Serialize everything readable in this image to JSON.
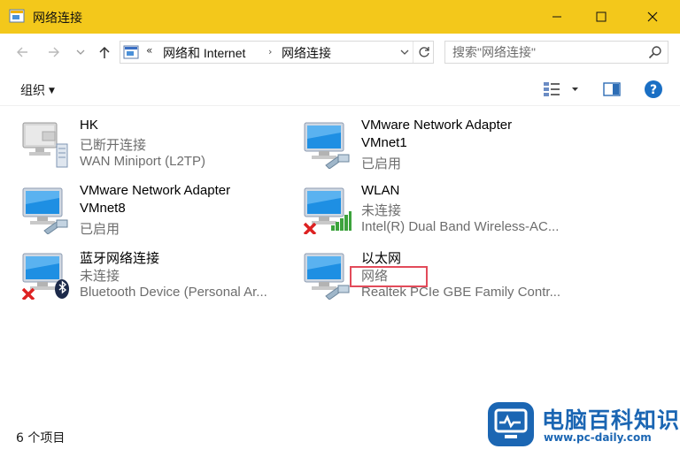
{
  "window": {
    "title": "网络连接",
    "accent_color": "#f3c81b"
  },
  "address_bar": {
    "overflow_chevron": "«",
    "crumbs": [
      "网络和 Internet",
      "网络连接"
    ],
    "separator": "›"
  },
  "search": {
    "placeholder": "搜索\"网络连接\""
  },
  "toolbar": {
    "organize_label": "组织",
    "help_label": "?"
  },
  "items": [
    {
      "name": "HK",
      "line1": "已断开连接",
      "line2": "WAN Miniport (L2TP)",
      "icon": "vpn-connection-icon"
    },
    {
      "name": "VMware Network Adapter",
      "name2": "VMnet1",
      "line2": "已启用",
      "icon": "network-adapter-icon"
    },
    {
      "name": "VMware Network Adapter",
      "name2": "VMnet8",
      "line2": "已启用",
      "icon": "network-adapter-icon"
    },
    {
      "name": "WLAN",
      "line1": "未连接",
      "line2": "Intel(R) Dual Band Wireless-AC...",
      "icon": "wifi-adapter-icon",
      "status": "disconnected"
    },
    {
      "name": "蓝牙网络连接",
      "line1": "未连接",
      "line2": "Bluetooth Device (Personal Ar...",
      "icon": "bluetooth-adapter-icon",
      "status": "disconnected"
    },
    {
      "name": "以太网",
      "line1": "网络",
      "line2": "Realtek PCIe GBE Family Contr...",
      "icon": "ethernet-adapter-icon"
    }
  ],
  "status_bar": {
    "item_count": "6 个项目"
  },
  "watermark": {
    "title": "电脑百科知识",
    "url": "www.pc-daily.com"
  }
}
